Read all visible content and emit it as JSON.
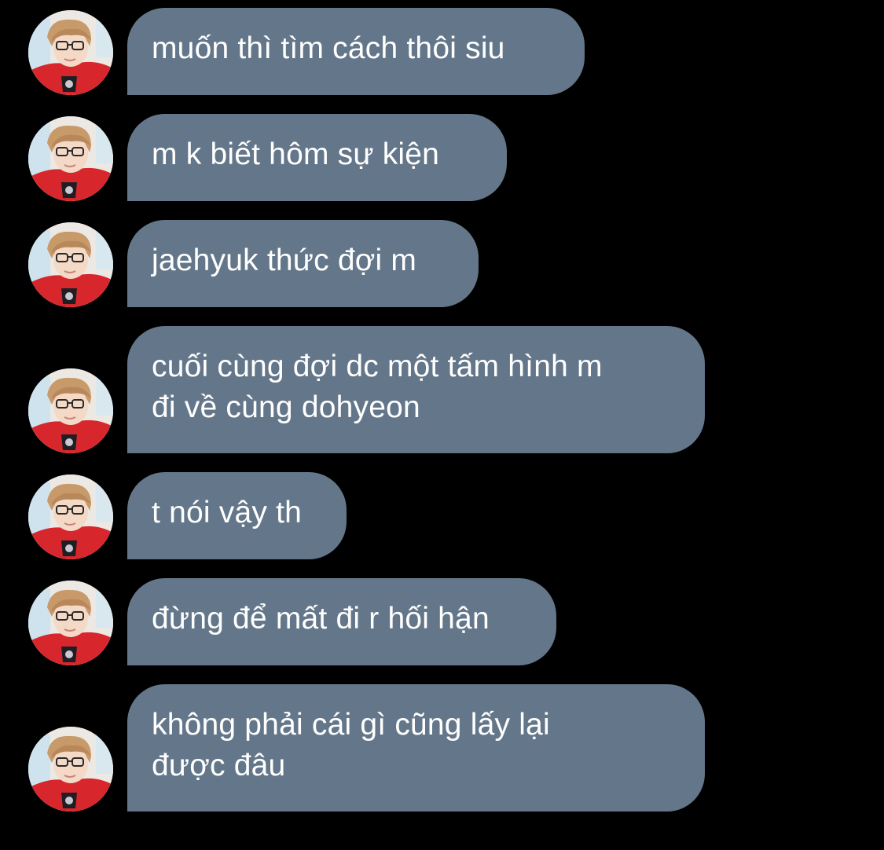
{
  "chat": {
    "background_color": "#000000",
    "bubble_color": "#64778a",
    "text_color": "#ffffff",
    "avatar_icon": "user-avatar-icon",
    "messages": [
      {
        "lines": [
          "muốn thì tìm cách thôi siu"
        ]
      },
      {
        "lines": [
          "m k biết hôm sự kiện"
        ]
      },
      {
        "lines": [
          "jaehyuk thức đợi m"
        ]
      },
      {
        "lines": [
          "cuối cùng đợi dc một tấm hình m",
          "đi về cùng dohyeon"
        ]
      },
      {
        "lines": [
          "t nói vậy th"
        ]
      },
      {
        "lines": [
          "đừng để mất đi r hối hận"
        ]
      },
      {
        "lines": [
          "không phải cái gì cũng lấy lại",
          "được đâu"
        ]
      }
    ]
  }
}
